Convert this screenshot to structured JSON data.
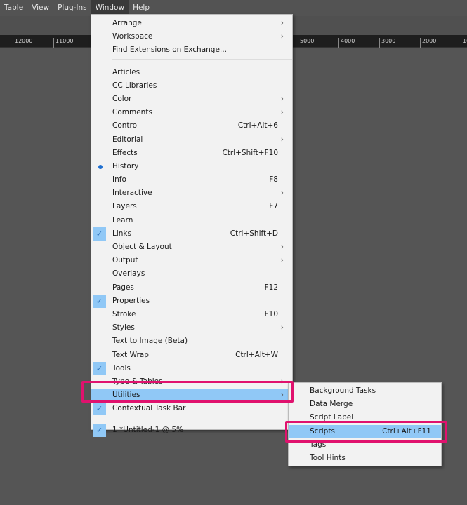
{
  "menubar": {
    "items": [
      "Table",
      "View",
      "Plug-Ins",
      "Window",
      "Help"
    ],
    "active": "Window"
  },
  "ruler": {
    "ticks": [
      "12000",
      "11000",
      "5000",
      "4000",
      "3000",
      "2000",
      "10"
    ]
  },
  "window_menu": {
    "groups": [
      [
        {
          "label": "Arrange",
          "submenu": true
        },
        {
          "label": "Workspace",
          "submenu": true
        },
        {
          "label": "Find Extensions on Exchange..."
        }
      ],
      [
        {
          "label": "Articles"
        },
        {
          "label": "CC Libraries"
        },
        {
          "label": "Color",
          "submenu": true
        },
        {
          "label": "Comments",
          "submenu": true
        },
        {
          "label": "Control",
          "shortcut": "Ctrl+Alt+6"
        },
        {
          "label": "Editorial",
          "submenu": true
        },
        {
          "label": "Effects",
          "shortcut": "Ctrl+Shift+F10"
        },
        {
          "label": "History",
          "mark": "dot"
        },
        {
          "label": "Info",
          "shortcut": "F8"
        },
        {
          "label": "Interactive",
          "submenu": true
        },
        {
          "label": "Layers",
          "shortcut": "F7"
        },
        {
          "label": "Learn"
        },
        {
          "label": "Links",
          "shortcut": "Ctrl+Shift+D",
          "mark": "check"
        },
        {
          "label": "Object & Layout",
          "submenu": true
        },
        {
          "label": "Output",
          "submenu": true
        },
        {
          "label": "Overlays"
        },
        {
          "label": "Pages",
          "shortcut": "F12"
        },
        {
          "label": "Properties",
          "mark": "check"
        },
        {
          "label": "Stroke",
          "shortcut": "F10"
        },
        {
          "label": "Styles",
          "submenu": true
        },
        {
          "label": "Text to Image (Beta)"
        },
        {
          "label": "Text Wrap",
          "shortcut": "Ctrl+Alt+W"
        },
        {
          "label": "Tools",
          "mark": "check"
        },
        {
          "label": "Type & Tables",
          "submenu": true
        },
        {
          "label": "Utilities",
          "submenu": true,
          "highlighted": true
        },
        {
          "label": "Contextual Task Bar",
          "mark": "check"
        }
      ],
      [
        {
          "label": "1 *Untitled-1 @ 5%",
          "mark": "check"
        }
      ]
    ]
  },
  "utilities_submenu": {
    "items": [
      {
        "label": "Background Tasks"
      },
      {
        "label": "Data Merge"
      },
      {
        "label": "Script Label"
      },
      {
        "label": "Scripts",
        "shortcut": "Ctrl+Alt+F11",
        "highlighted": true
      },
      {
        "label": "Tags"
      },
      {
        "label": "Tool Hints"
      }
    ]
  },
  "colors": {
    "highlight": "#90c8f6",
    "annotation": "#e0126e",
    "menu_bg": "#f2f2f2"
  }
}
